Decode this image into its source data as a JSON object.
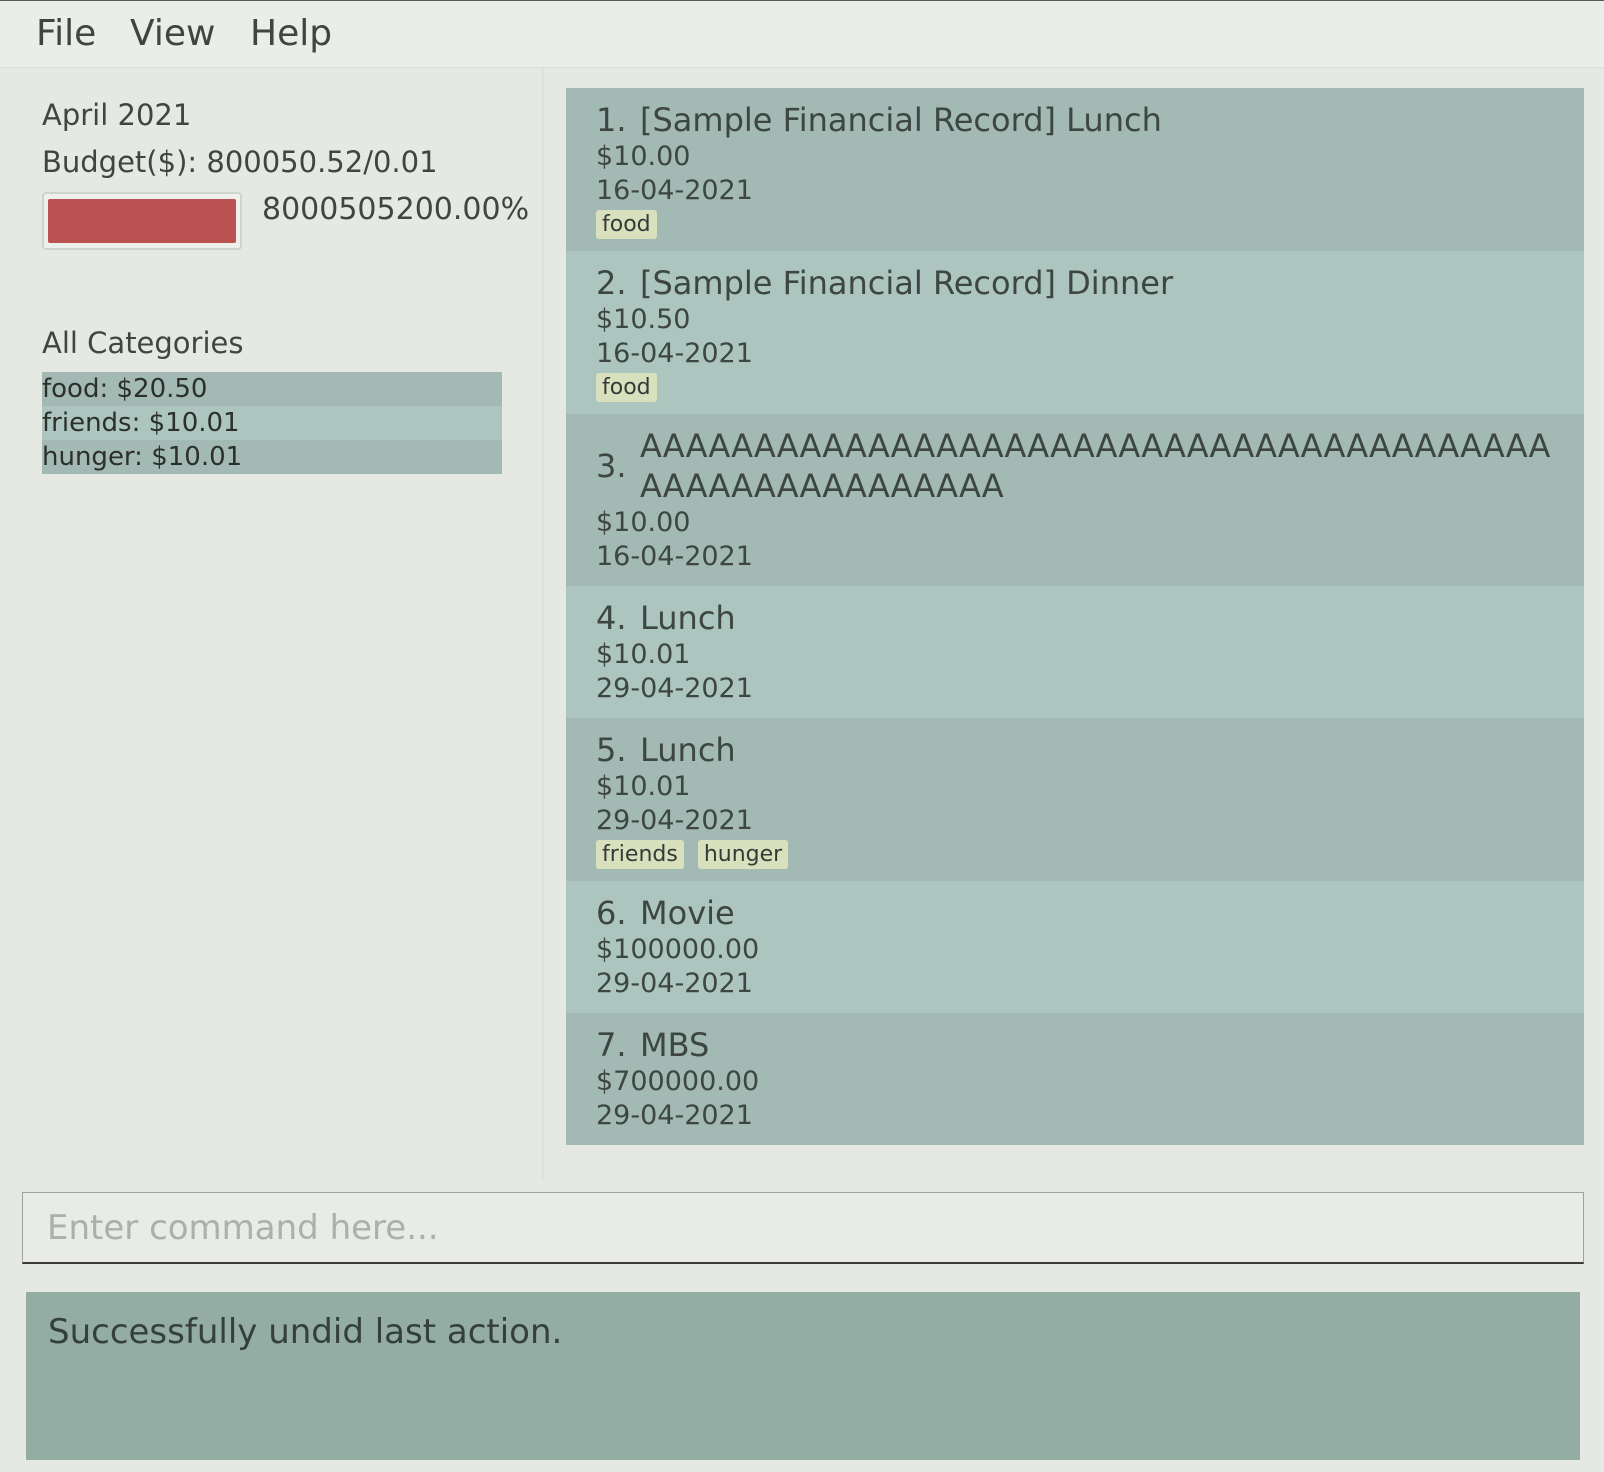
{
  "menu": {
    "file": "File",
    "view": "View",
    "help": "Help"
  },
  "summary": {
    "month": "April 2021",
    "budget": "Budget($): 800050.52/0.01",
    "percent": "8000505200.00%",
    "progress_fraction": 1.0,
    "progress_color": "#b95250"
  },
  "categories": {
    "title": "All Categories",
    "items": [
      "food: $20.50",
      "friends: $10.01",
      "hunger: $10.01"
    ]
  },
  "records": [
    {
      "index": "1.",
      "title": "[Sample Financial Record] Lunch",
      "amount": "$10.00",
      "date": "16-04-2021",
      "tags": [
        "food"
      ]
    },
    {
      "index": "2.",
      "title": "[Sample Financial Record] Dinner",
      "amount": "$10.50",
      "date": "16-04-2021",
      "tags": [
        "food"
      ]
    },
    {
      "index": "3.",
      "title": "AAAAAAAAAAAAAAAAAAAAAAAAAAAAAAAAAAAAAAAAAAAAAAAAAAAAAAAA",
      "amount": "$10.00",
      "date": "16-04-2021",
      "tags": []
    },
    {
      "index": "4.",
      "title": "Lunch",
      "amount": "$10.01",
      "date": "29-04-2021",
      "tags": []
    },
    {
      "index": "5.",
      "title": "Lunch",
      "amount": "$10.01",
      "date": "29-04-2021",
      "tags": [
        "friends",
        "hunger"
      ]
    },
    {
      "index": "6.",
      "title": "Movie",
      "amount": "$100000.00",
      "date": "29-04-2021",
      "tags": []
    },
    {
      "index": "7.",
      "title": "MBS",
      "amount": "$700000.00",
      "date": "29-04-2021",
      "tags": []
    }
  ],
  "command": {
    "placeholder": "Enter command here...",
    "value": ""
  },
  "result": {
    "message": "Successfully undid last action."
  }
}
